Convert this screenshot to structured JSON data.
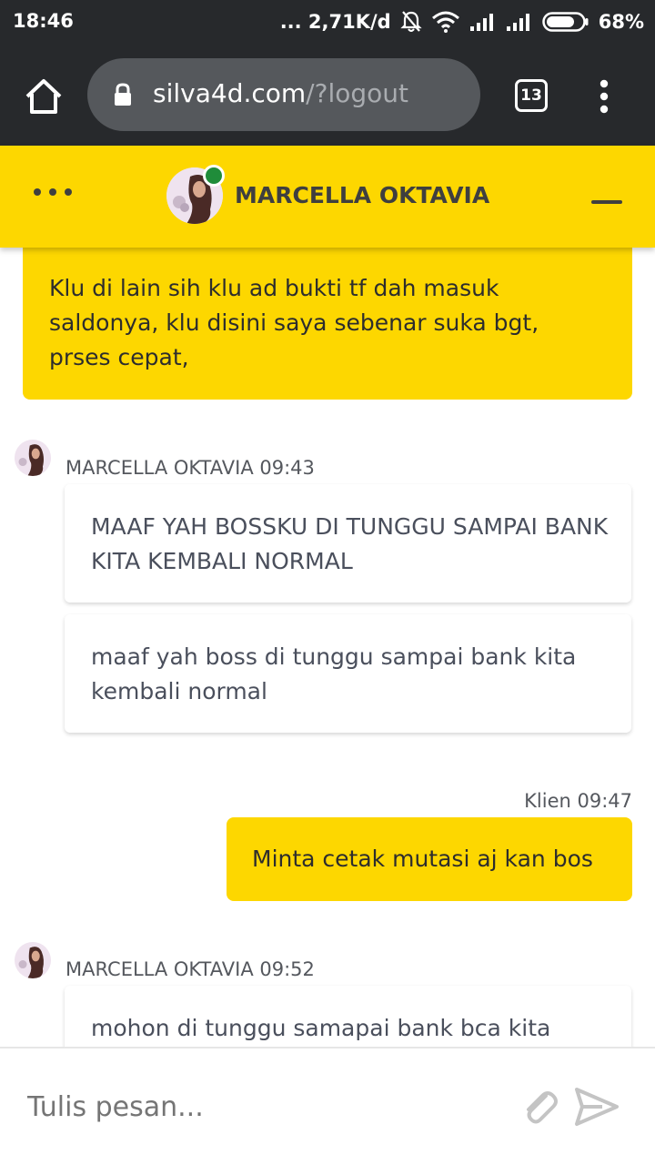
{
  "status_bar": {
    "time": "18:46",
    "network_speed": "... 2,71K/d",
    "battery": "68%",
    "icons": [
      "mute-bell-icon",
      "wifi-icon",
      "signal-icon",
      "signal-icon",
      "battery-icon"
    ]
  },
  "browser": {
    "url_host": "silva4d.com",
    "url_path": "/?logout",
    "tab_count": "13",
    "icons": [
      "home-icon",
      "lock-icon",
      "tabs-icon",
      "more-vert-icon"
    ]
  },
  "chat": {
    "agent_name": "MARCELLA OKTAVIA",
    "header_icons": [
      "more-horiz-icon",
      "avatar",
      "online-indicator",
      "minimize-icon"
    ],
    "messages": [
      {
        "from": "client",
        "text": "Klu di lain sih klu ad bukti tf dah masuk saldonya, klu disini saya sebenar suka bgt, prses cepat,"
      },
      {
        "from": "agent",
        "meta": "MARCELLA OKTAVIA 09:43",
        "text": "MAAF YAH BOSSKU DI TUNGGU SAMPAI BANK KITA KEMBALI NORMAL"
      },
      {
        "from": "agent",
        "text": "maaf yah boss di tunggu sampai bank kita kembali normal"
      },
      {
        "from": "client",
        "meta": "Klien 09:47",
        "text": "Minta cetak mutasi aj kan bos"
      },
      {
        "from": "agent",
        "meta": "MARCELLA OKTAVIA 09:52",
        "text": "mohon di tunggu samapai bank bca kita"
      }
    ]
  },
  "composer": {
    "placeholder": "Tulis pesan...",
    "icons": [
      "attach-icon",
      "send-icon"
    ]
  },
  "colors": {
    "accent_yellow": "#fdd700",
    "browser_dark": "#27292c",
    "online_green": "#1f8c3a"
  }
}
